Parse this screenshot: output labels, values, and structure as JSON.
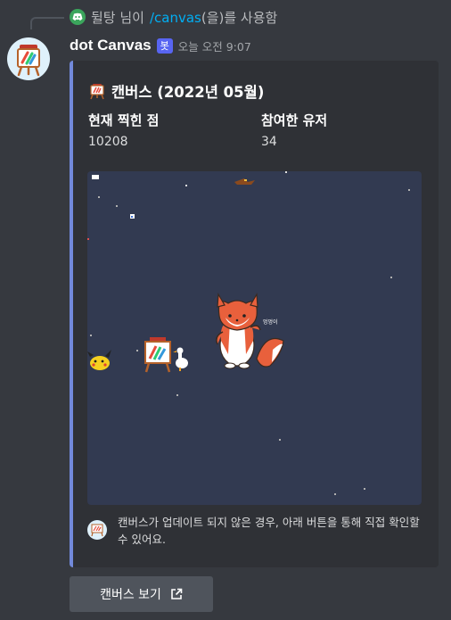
{
  "reply": {
    "user_name": "뒬탕 님이",
    "command": "/canvas",
    "suffix": "(을)를 사용함"
  },
  "message": {
    "author": "dot Canvas",
    "bot_tag": "봇",
    "timestamp": "오늘 오전 9:07"
  },
  "embed": {
    "accent_color": "#7289da",
    "title": "캔버스 (2022년 05월)",
    "fields": [
      {
        "name": "현재 찍힌 점",
        "value": "10208"
      },
      {
        "name": "참여한 유저",
        "value": "34"
      }
    ],
    "image": {
      "background": "#323a51",
      "caption": "멍멍이"
    },
    "footer_text": "캔버스가 업데이트 되지 않은 경우, 아래 버튼을 통해 직접 확인할 수 있어요."
  },
  "button": {
    "label": "캔버스 보기",
    "icon": "external-link-icon"
  }
}
